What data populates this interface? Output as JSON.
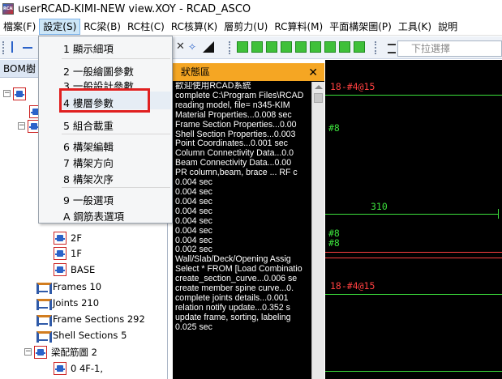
{
  "window": {
    "title": "userRCAD-KIMI-NEW view.XOY  - RCAD_ASCO",
    "app_icon_text": "RCAD"
  },
  "menubar": [
    {
      "label": "檔案(F)",
      "active": false
    },
    {
      "label": "設定(S)",
      "active": true
    },
    {
      "label": "RC梁(B)",
      "active": false
    },
    {
      "label": "RC柱(C)",
      "active": false
    },
    {
      "label": "RC核算(K)",
      "active": false
    },
    {
      "label": "層剪力(U)",
      "active": false
    },
    {
      "label": "RC算料(M)",
      "active": false
    },
    {
      "label": "平面構架圖(P)",
      "active": false
    },
    {
      "label": "工具(K)",
      "active": false
    },
    {
      "label": "說明",
      "active": false
    }
  ],
  "toolbar": {
    "select_placeholder": "下拉選擇"
  },
  "settings_menu": {
    "items": [
      {
        "label": "1 顯示細項"
      },
      {
        "label": "2 一般繪圖參數"
      },
      {
        "label": "3 一般設計參數"
      },
      {
        "label": "4 樓層參數",
        "highlighted": true
      },
      {
        "label": "5 組合載重"
      },
      {
        "label": "6 構架編輯"
      },
      {
        "label": "7 構架方向"
      },
      {
        "label": "8 構架次序"
      },
      {
        "label": "9 一般選項"
      },
      {
        "label": "A 鋼筋表選項"
      }
    ]
  },
  "left_panel": {
    "title": "BOM樹",
    "tree": [
      {
        "label": "2F",
        "icon": "node"
      },
      {
        "label": "1F",
        "icon": "node"
      },
      {
        "label": "BASE",
        "icon": "node"
      },
      {
        "label": "Frames 10",
        "icon": "frame"
      },
      {
        "label": "Joints 210",
        "icon": "frame"
      },
      {
        "label": "Frame Sections 292",
        "icon": "frame"
      },
      {
        "label": "Shell Sections 5",
        "icon": "frame"
      },
      {
        "label": "梁配筋圖 2",
        "icon": "node"
      },
      {
        "label": "0 4F-1,",
        "icon": "node"
      }
    ]
  },
  "status_panel": {
    "title": "狀態區",
    "log": [
      "歡迎使用RCAD系統",
      "complete C:\\Program Files\\RCAD",
      "   reading model, file= n345-KIM",
      "   Material Properties...0.008 sec",
      "   Frame Section Properties...0.00",
      "   Shell Section Properties...0.003",
      "   Point Coordinates...0.001 sec",
      "   Column Connectivity Data...0.0",
      "   Beam Connectivity Data...0.00",
      "   PR column,beam, brace ...  RF c",
      "0.004 sec",
      "0.004 sec",
      "0.004 sec",
      "0.004 sec",
      "0.004 sec",
      "0.004 sec",
      "0.004 sec",
      "0.002 sec",
      "   Wall/Slab/Deck/Opening Assig",
      "Select * FROM [Load Combinatio",
      "   create_section_curve...0.006 se",
      "   create member spine curve...0.",
      "   complete joints details...0.001",
      "   relation notify update...0.352 s",
      "   update frame, sorting, labeling",
      "0.025 sec"
    ]
  },
  "canvas": {
    "labels": [
      {
        "text": "18-#4@15",
        "color": "red"
      },
      {
        "text": "#8",
        "color": "green"
      },
      {
        "text": "310",
        "color": "green"
      },
      {
        "text": "#8",
        "color": "green"
      },
      {
        "text": "#8",
        "color": "green"
      },
      {
        "text": "18-#4@15",
        "color": "red"
      }
    ]
  }
}
